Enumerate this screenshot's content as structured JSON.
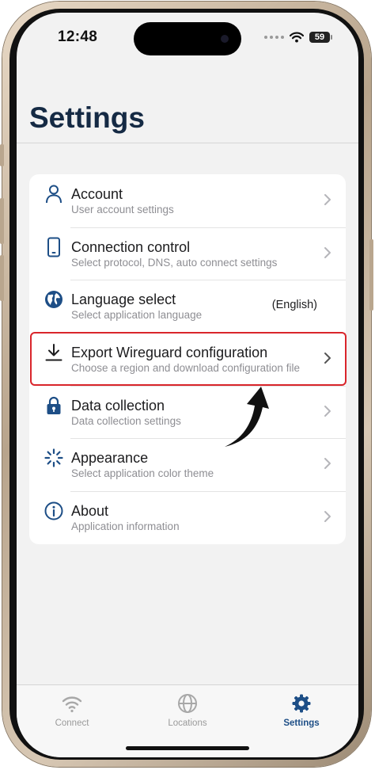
{
  "status_bar": {
    "time": "12:48",
    "battery": "59",
    "icons": [
      "signal-dots-icon",
      "wifi-icon",
      "battery-icon"
    ]
  },
  "header": {
    "title": "Settings"
  },
  "settings": {
    "items": [
      {
        "icon": "person-icon",
        "title": "Account",
        "subtitle": "User account settings",
        "value": ""
      },
      {
        "icon": "phone-icon",
        "title": "Connection control",
        "subtitle": "Select protocol, DNS, auto connect settings",
        "value": ""
      },
      {
        "icon": "globe-icon",
        "title": "Language select",
        "subtitle": "Select application language",
        "value": "(English)"
      },
      {
        "icon": "download-icon",
        "title": "Export Wireguard configuration",
        "subtitle": "Choose a region and download configuration file",
        "value": ""
      },
      {
        "icon": "lock-icon",
        "title": "Data collection",
        "subtitle": "Data collection settings",
        "value": ""
      },
      {
        "icon": "spinner-icon",
        "title": "Appearance",
        "subtitle": "Select application color theme",
        "value": ""
      },
      {
        "icon": "info-icon",
        "title": "About",
        "subtitle": "Application information",
        "value": ""
      }
    ]
  },
  "tab_bar": {
    "tabs": [
      {
        "icon": "wifi-icon",
        "label": "Connect",
        "active": false
      },
      {
        "icon": "globe-icon",
        "label": "Locations",
        "active": false
      },
      {
        "icon": "gear-icon",
        "label": "Settings",
        "active": true
      }
    ]
  },
  "colors": {
    "accent": "#1d4e86",
    "title": "#152a44",
    "highlight": "#d9252b",
    "inactive": "#9a9a9a"
  }
}
